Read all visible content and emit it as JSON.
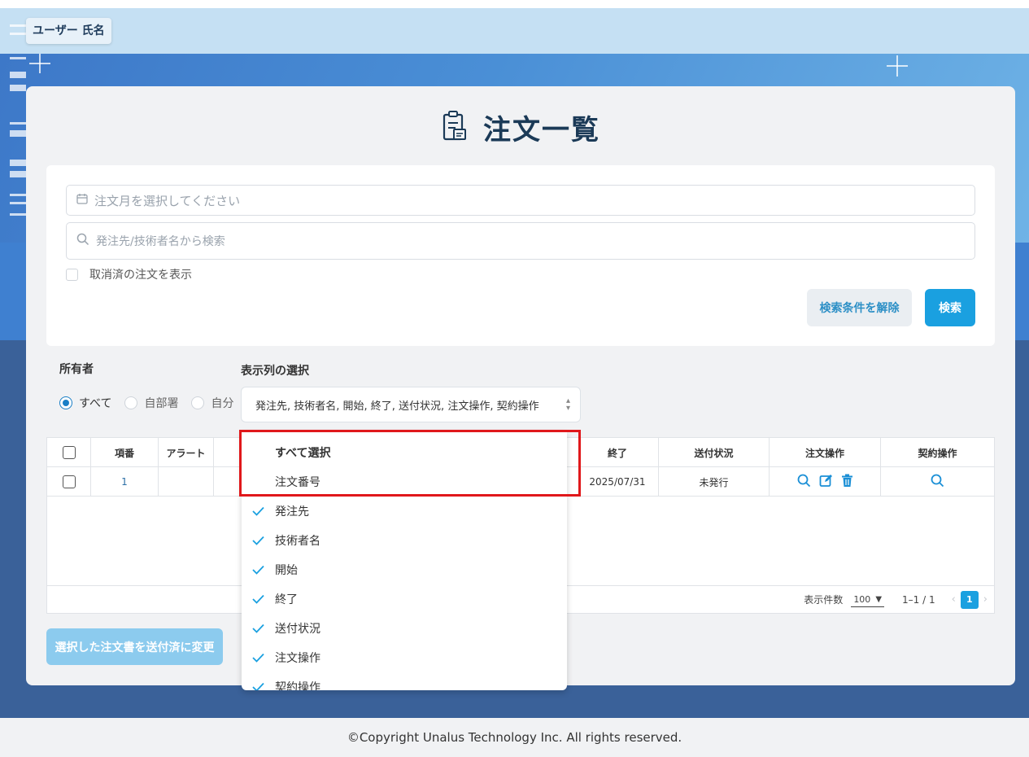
{
  "user": {
    "name": "ユーザー 氏名"
  },
  "page": {
    "title": "注文一覧"
  },
  "search": {
    "date_placeholder": "注文月を選択してください",
    "text_placeholder": "発注先/技術者名から検索",
    "show_cancelled_label": "取消済の注文を表示",
    "clear_button": "検索条件を解除",
    "search_button": "検索"
  },
  "owner": {
    "label": "所有者",
    "options": [
      "すべて",
      "自部署",
      "自分"
    ],
    "selected": "すべて"
  },
  "columns_select": {
    "label": "表示列の選択",
    "value": "発注先, 技術者名, 開始, 終了, 送付状況, 注文操作, 契約操作"
  },
  "table": {
    "headers": [
      "項番",
      "アラート",
      "終了",
      "送付状況",
      "注文操作",
      "契約操作"
    ],
    "rows": [
      {
        "no": "1",
        "alert": "",
        "end": "2025/07/31",
        "status": "未発行"
      }
    ],
    "footer": {
      "per_page_label": "表示件数",
      "per_page_value": "100",
      "range": "1–1 / 1",
      "page": "1"
    }
  },
  "bulk_button": "選択した注文書を送付済に変更",
  "dropdown": {
    "items": [
      {
        "label": "すべて選択",
        "checked": false
      },
      {
        "label": "注文番号",
        "checked": false
      },
      {
        "label": "発注先",
        "checked": true
      },
      {
        "label": "技術者名",
        "checked": true
      },
      {
        "label": "開始",
        "checked": true
      },
      {
        "label": "終了",
        "checked": true
      },
      {
        "label": "送付状況",
        "checked": true
      },
      {
        "label": "注文操作",
        "checked": true
      },
      {
        "label": "契約操作",
        "checked": true
      }
    ]
  },
  "footer": {
    "copyright": "©Copyright Unalus Technology Inc. All rights reserved."
  },
  "colors": {
    "accent": "#1aa0e0",
    "highlight": "#e0181b",
    "title": "#1b3a57"
  }
}
